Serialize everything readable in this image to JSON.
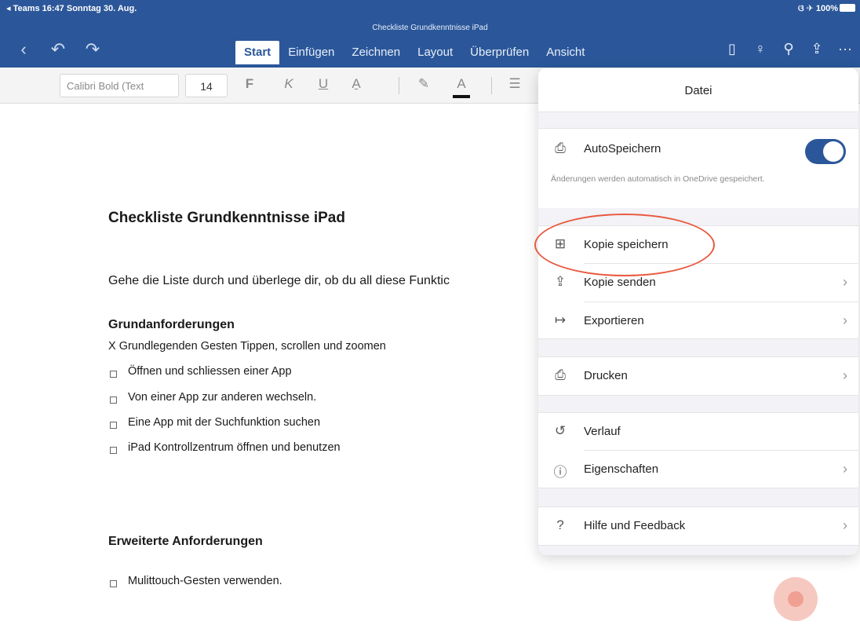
{
  "status_bar": {
    "left": "◂ Teams  16:47  Sonntag 30. Aug.",
    "right": "ଓ ✈ 100%"
  },
  "document_title": "Checkliste Grundkenntnisse iPad",
  "toolbar": {
    "tabs": [
      "Start",
      "Einfügen",
      "Zeichnen",
      "Layout",
      "Überprüfen",
      "Ansicht"
    ],
    "active_tab": "Start"
  },
  "ribbon": {
    "font": "Calibri Bold (Text",
    "size": "14",
    "bold": "F",
    "italic": "K",
    "underline": "U",
    "font_color_label": "A"
  },
  "document": {
    "heading": "Checkliste Grundkenntnisse iPad",
    "intro": "Gehe die Liste durch und überlege dir, ob du all diese Funktic",
    "section1": "Grundanforderungen",
    "x_line": "X Grundlegenden Gesten Tippen, scrollen und zoomen",
    "items": [
      "Öffnen und schliessen einer App",
      "Von einer App zur anderen wechseln.",
      "Eine App mit der Suchfunktion suchen",
      "iPad Kontrollzentrum öffnen und benutzen"
    ],
    "section2": "Erweiterte Anforderungen",
    "items2": [
      "Mulittouch-Gesten verwenden."
    ]
  },
  "file_panel": {
    "title": "Datei",
    "autosave": {
      "label": "AutoSpeichern",
      "on": true
    },
    "autosave_note": "Änderungen werden automatisch in OneDrive gespeichert.",
    "items": {
      "save_copy": "Kopie speichern",
      "send_copy": "Kopie senden",
      "export": "Exportieren",
      "print": "Drucken",
      "history": "Verlauf",
      "properties": "Eigenschaften",
      "help": "Hilfe und Feedback"
    }
  },
  "colors": {
    "accent": "#2b579a",
    "annotation": "#e8593f"
  }
}
